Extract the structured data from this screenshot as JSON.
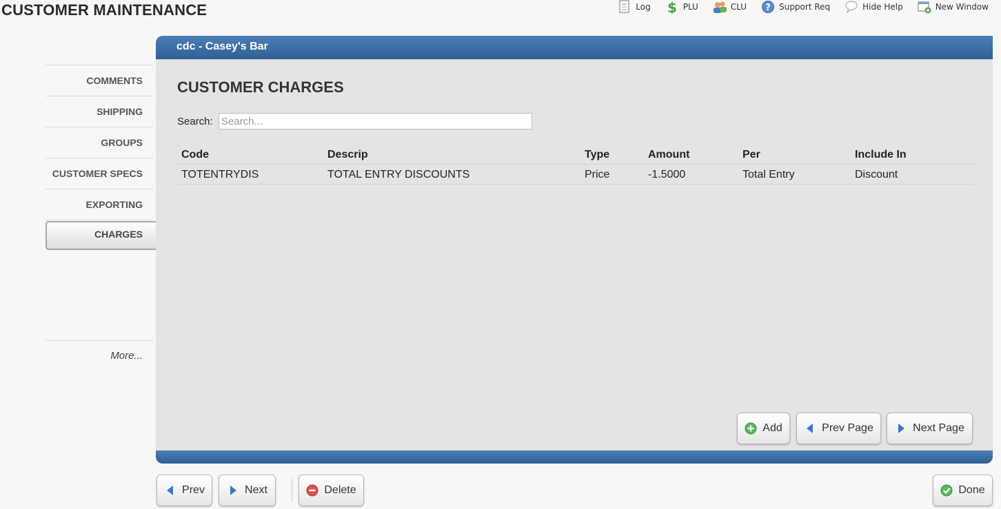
{
  "page": {
    "title": "CUSTOMER MAINTENANCE"
  },
  "toolbar": {
    "log": "Log",
    "plu": "PLU",
    "clu": "CLU",
    "support": "Support Req",
    "hide_help": "Hide Help",
    "new_window": "New Window"
  },
  "sidebar": {
    "items": [
      {
        "label": "COMMENTS"
      },
      {
        "label": "SHIPPING"
      },
      {
        "label": "GROUPS"
      },
      {
        "label": "CUSTOMER SPECS"
      },
      {
        "label": "EXPORTING"
      },
      {
        "label": "CHARGES"
      }
    ],
    "more": "More..."
  },
  "panel": {
    "header": "cdc - Casey's Bar",
    "section_title": "CUSTOMER CHARGES",
    "search_label": "Search:",
    "search_placeholder": "Search...",
    "columns": [
      "Code",
      "Descrip",
      "Type",
      "Amount",
      "Per",
      "Include In"
    ],
    "rows": [
      [
        "TOTENTRYDIS",
        "TOTAL ENTRY DISCOUNTS",
        "Price",
        "-1.5000",
        "Total Entry",
        "Discount"
      ]
    ],
    "add_label": "Add",
    "prev_page_label": "Prev Page",
    "next_page_label": "Next Page"
  },
  "footer": {
    "prev_label": "Prev",
    "next_label": "Next",
    "delete_label": "Delete",
    "done_label": "Done"
  },
  "colors": {
    "header_blue": "#2f5f95",
    "panel_gray": "#e4e4e4",
    "add_green": "#5cb85c",
    "delete_red": "#d9534f",
    "arrow_blue": "#3a78c9"
  }
}
